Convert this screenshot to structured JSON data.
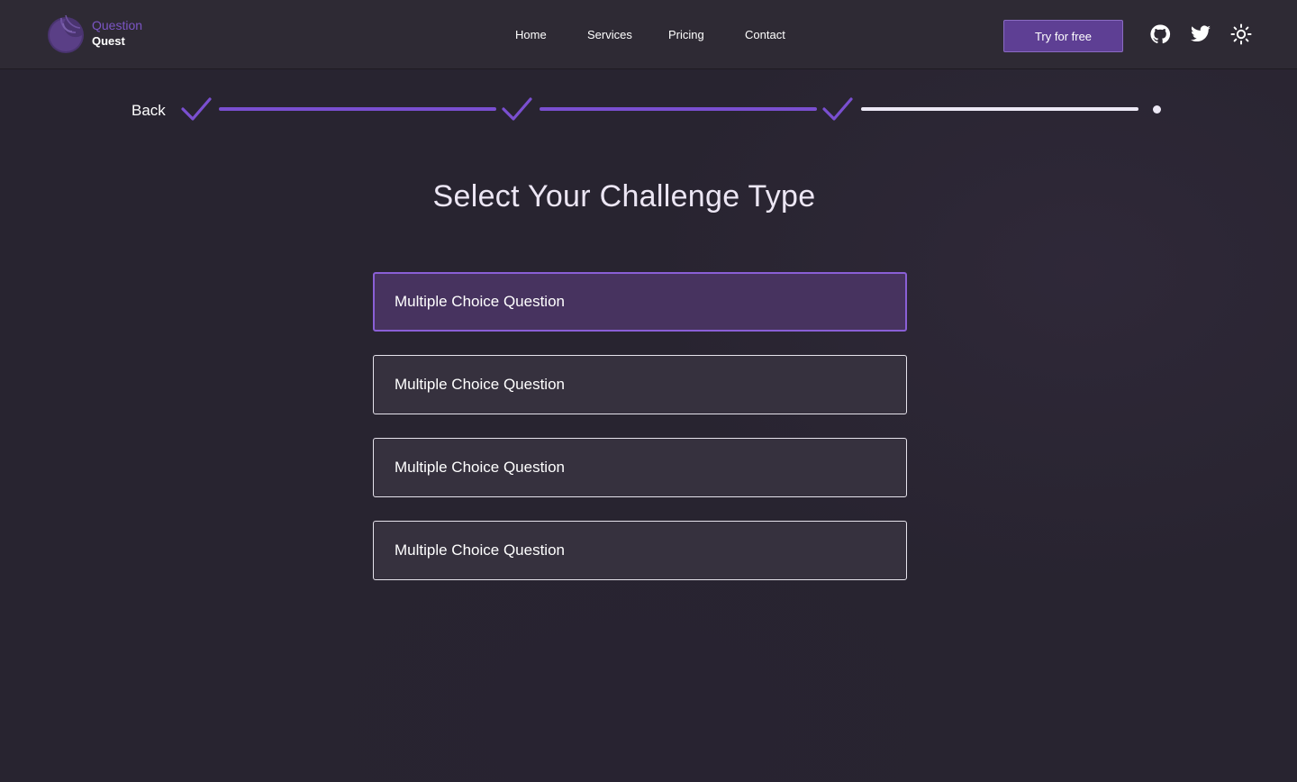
{
  "brand": {
    "name_line1": "Question",
    "name_line2": "Quest",
    "logo_icon": "crescent-swirl-icon",
    "colors": {
      "accent": "#7a4fd0",
      "button": "#5e3f94",
      "background": "#282430",
      "header": "#2e2a34",
      "selected_option": "#47335f"
    }
  },
  "nav": {
    "items": [
      {
        "label": "Home"
      },
      {
        "label": "Services"
      },
      {
        "label": "Pricing"
      },
      {
        "label": "Contact"
      }
    ]
  },
  "header_actions": {
    "cta_label": "Try for free",
    "icons": [
      "github-icon",
      "twitter-icon",
      "sun-icon"
    ]
  },
  "stepper": {
    "back_label": "Back",
    "completed_steps": 3,
    "total_steps": 4,
    "check_icon": "checkmark-icon"
  },
  "main": {
    "title": "Select Your Challenge Type",
    "options": [
      {
        "label": "Multiple Choice Question",
        "selected": true
      },
      {
        "label": "Multiple Choice Question",
        "selected": false
      },
      {
        "label": "Multiple Choice Question",
        "selected": false
      },
      {
        "label": "Multiple Choice Question",
        "selected": false
      }
    ]
  }
}
